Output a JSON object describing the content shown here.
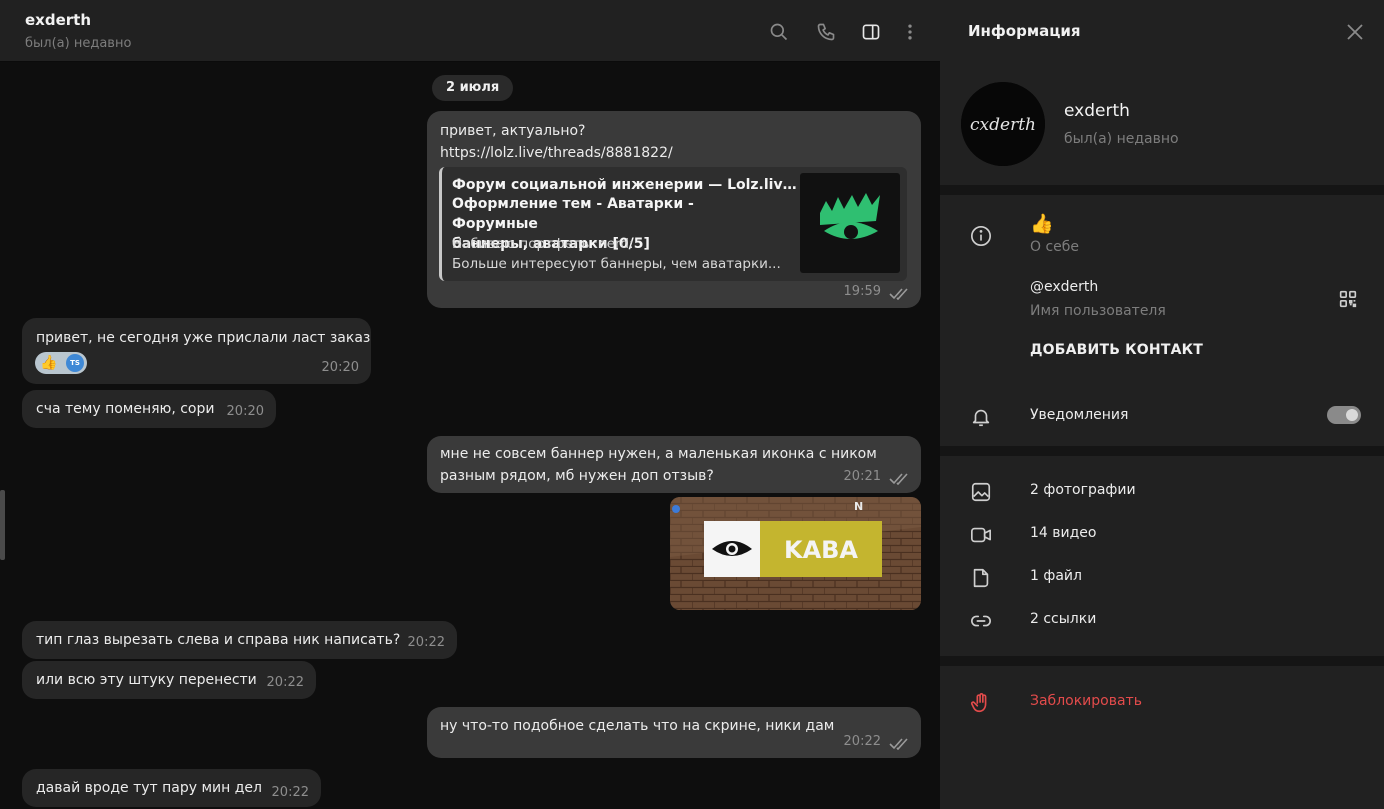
{
  "header": {
    "title": "exderth",
    "status": "был(а) недавно",
    "icons": [
      "search-icon",
      "phone-icon",
      "sidebar-toggle-icon",
      "more-vertical-icon"
    ]
  },
  "date_separator": "2 июля",
  "messages": [
    {
      "direction": "out",
      "text": "привет, актуально?\nhttps://lolz.live/threads/8881822/",
      "preview": {
        "site": "Форум социальной инженерии — Lolz.live ...",
        "title": "Оформление тем - Аватарки - Форумные\nбаннеры, аватарки [0/5]",
        "description": "Набиваю портфель :nerd:\nБольше интересуют баннеры, чем аватарки..."
      },
      "time": "19:59",
      "read": true
    },
    {
      "direction": "in",
      "text": "привет, не сегодня уже прислали ласт заказ",
      "reaction": {
        "emoji": "👍",
        "avatar_initials": "TS"
      },
      "time": "20:20"
    },
    {
      "direction": "in",
      "text": "сча тему поменяю, сори",
      "time": "20:20"
    },
    {
      "direction": "out",
      "text": "мне не совсем баннер нужен, а маленькая иконка с ником\nразным рядом, мб нужен доп отзыв?",
      "time": "20:21",
      "read": true
    },
    {
      "direction": "out",
      "type": "photo",
      "photo_text": "KABA",
      "photo_compass": "N"
    },
    {
      "direction": "in",
      "text": "тип глаз вырезать слева и справа ник написать?",
      "time": "20:22"
    },
    {
      "direction": "in",
      "text": "или всю эту штуку перенести",
      "time": "20:22"
    },
    {
      "direction": "out",
      "text": "ну что-то подобное сделать что на скрине, ники дам",
      "time": "20:22",
      "read": true
    },
    {
      "direction": "in",
      "text": "давай вроде тут пару мин дел",
      "time": "20:22"
    }
  ],
  "info_panel": {
    "title": "Информация",
    "profile": {
      "name": "exderth",
      "status": "был(а) недавно",
      "avatar_text": "cxderth"
    },
    "bio": {
      "value": "👍",
      "label": "О себе"
    },
    "username": {
      "value": "@exderth",
      "label": "Имя пользователя"
    },
    "add_contact": "ДОБАВИТЬ КОНТАКТ",
    "notifications": {
      "label": "Уведомления",
      "enabled": true
    },
    "media": [
      {
        "icon": "photo-icon",
        "label": "2 фотографии"
      },
      {
        "icon": "video-icon",
        "label": "14 видео"
      },
      {
        "icon": "file-icon",
        "label": "1 файл"
      },
      {
        "icon": "link-icon",
        "label": "2 ссылки"
      }
    ],
    "block": "Заблокировать"
  },
  "colors": {
    "chat_background": "#0e0e0e",
    "panel_background": "#212121",
    "outgoing_bubble": "#3a3a3a",
    "incoming_bubble": "#262626",
    "danger": "#e24b4b",
    "preview_logo": "#2fbf71"
  }
}
